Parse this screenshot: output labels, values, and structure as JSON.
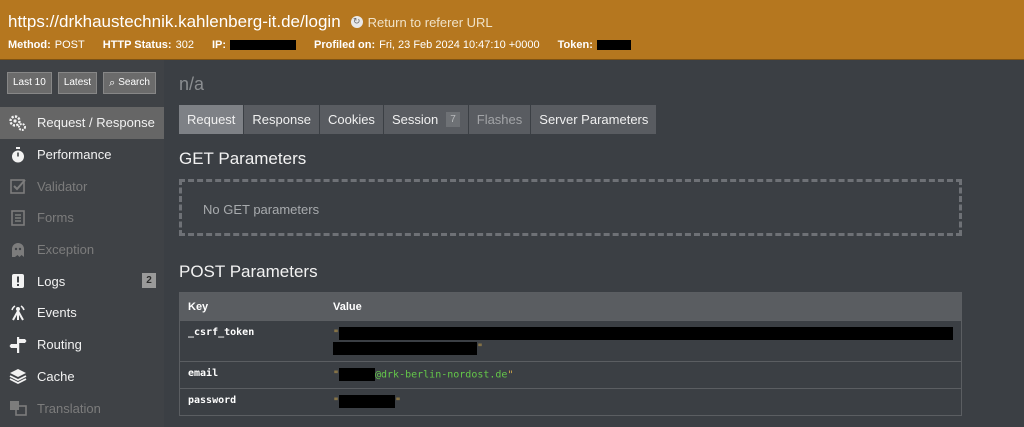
{
  "header": {
    "url": "https://drkhaustechnik.kahlenberg-it.de/login",
    "return_link": "Return to referer URL",
    "method_label": "Method:",
    "method_value": "POST",
    "status_label": "HTTP Status:",
    "status_value": "302",
    "ip_label": "IP:",
    "profiled_label": "Profiled on:",
    "profiled_value": "Fri, 23 Feb 2024 10:47:10 +0000",
    "token_label": "Token:"
  },
  "quick_buttons": {
    "last10": "Last 10",
    "latest": "Latest",
    "search": "Search"
  },
  "menu": [
    {
      "label": "Request / Response",
      "icon": "gears-icon",
      "active": true,
      "disabled": false
    },
    {
      "label": "Performance",
      "icon": "stopwatch-icon",
      "active": false,
      "disabled": false
    },
    {
      "label": "Validator",
      "icon": "checkbox-icon",
      "active": false,
      "disabled": true
    },
    {
      "label": "Forms",
      "icon": "form-icon",
      "active": false,
      "disabled": true
    },
    {
      "label": "Exception",
      "icon": "ghost-icon",
      "active": false,
      "disabled": true
    },
    {
      "label": "Logs",
      "icon": "alert-icon",
      "active": false,
      "disabled": false,
      "badge": "2"
    },
    {
      "label": "Events",
      "icon": "events-icon",
      "active": false,
      "disabled": false
    },
    {
      "label": "Routing",
      "icon": "signpost-icon",
      "active": false,
      "disabled": false
    },
    {
      "label": "Cache",
      "icon": "layers-icon",
      "active": false,
      "disabled": false
    },
    {
      "label": "Translation",
      "icon": "translate-icon",
      "active": false,
      "disabled": true
    }
  ],
  "main": {
    "title": "n/a",
    "tabs": [
      {
        "label": "Request",
        "active": true
      },
      {
        "label": "Response"
      },
      {
        "label": "Cookies"
      },
      {
        "label": "Session",
        "count": "7"
      },
      {
        "label": "Flashes",
        "disabled": true
      },
      {
        "label": "Server Parameters"
      }
    ],
    "get_heading": "GET Parameters",
    "get_empty": "No GET parameters",
    "post_heading": "POST Parameters",
    "post_table": {
      "key_header": "Key",
      "value_header": "Value",
      "rows": [
        {
          "key": "_csrf_token",
          "value_prefix": "\"",
          "value_suffix": "\""
        },
        {
          "key": "email",
          "value_prefix": "\"",
          "domain": "@drk-berlin-nordost.de",
          "value_suffix": "\""
        },
        {
          "key": "password",
          "value_prefix": "\"",
          "value_suffix": "\""
        }
      ]
    }
  },
  "colors": {
    "header_bg": "#b5771f",
    "page_bg": "#3b3f44",
    "active_menu": "#666666",
    "string_green": "#64c84a"
  }
}
